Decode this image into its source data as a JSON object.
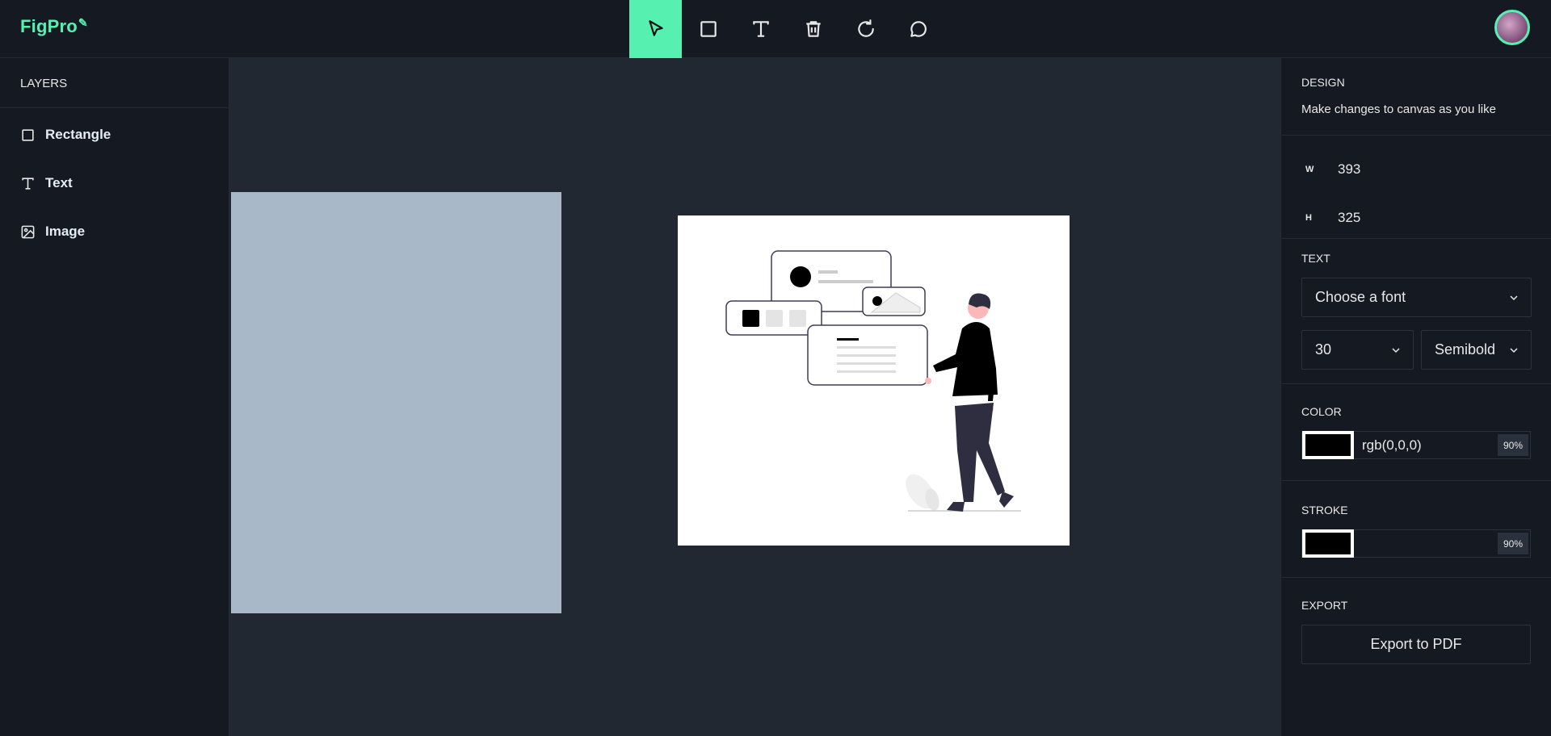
{
  "app": {
    "logo": "FigPro"
  },
  "toolbar": {
    "tools": [
      {
        "name": "select",
        "icon": "cursor-icon",
        "active": true
      },
      {
        "name": "rectangle",
        "icon": "square-icon"
      },
      {
        "name": "text",
        "icon": "text-icon"
      },
      {
        "name": "delete",
        "icon": "trash-icon"
      },
      {
        "name": "reset",
        "icon": "refresh-icon"
      },
      {
        "name": "comments",
        "icon": "chat-icon"
      }
    ],
    "accent": "#56f0b1"
  },
  "layers": {
    "title": "LAYERS",
    "items": [
      {
        "label": "Rectangle",
        "icon": "square-icon"
      },
      {
        "label": "Text",
        "icon": "text-icon"
      },
      {
        "label": "Image",
        "icon": "image-icon"
      }
    ]
  },
  "canvas": {
    "rect_color": "#a8b8c9",
    "image_background": "#ffffff"
  },
  "design": {
    "title": "DESIGN",
    "subtitle": "Make changes to canvas as you like",
    "width_label": "W",
    "width_value": "393",
    "height_label": "H",
    "height_value": "325"
  },
  "text": {
    "title": "TEXT",
    "font_placeholder": "Choose a font",
    "size": "30",
    "weight": "Semibold"
  },
  "color": {
    "title": "COLOR",
    "value": "rgb(0,0,0)",
    "opacity": "90%",
    "swatch": "#000000"
  },
  "stroke": {
    "title": "STROKE",
    "value": "",
    "opacity": "90%",
    "swatch": "#000000"
  },
  "export": {
    "title": "EXPORT",
    "button": "Export to PDF"
  }
}
